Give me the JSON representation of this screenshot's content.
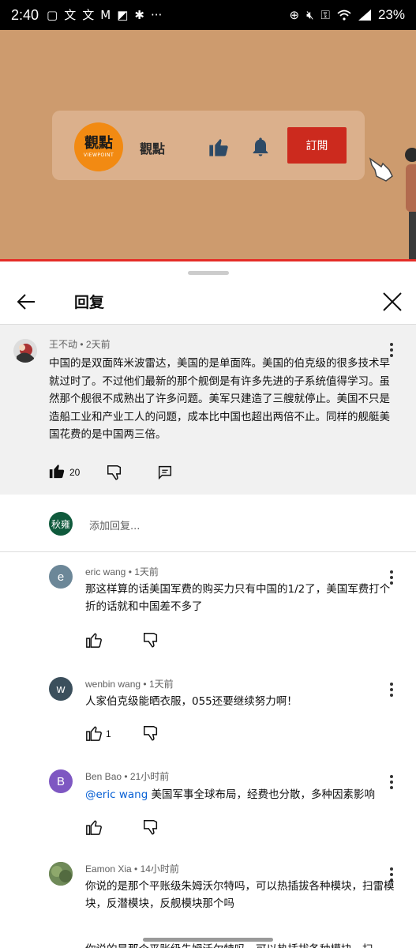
{
  "status_bar": {
    "time": "2:40",
    "battery": "23%",
    "left_icons": [
      "message-icon",
      "translate-icon",
      "translate-icon",
      "gmail-icon",
      "photo-icon",
      "maple-leaf-icon",
      "more-icon"
    ],
    "right_icons": [
      "add-circle-icon",
      "mute-icon",
      "key-icon",
      "wifi-icon",
      "signal-icon"
    ]
  },
  "video": {
    "channel_name": "觀點",
    "logo_text": "觀點",
    "logo_sub": "VIEWPOINT",
    "subscribe_label": "訂閱",
    "colors": {
      "background": "#cd9b6e",
      "subscribe": "#cc2a1e",
      "logo": "#f28a12"
    }
  },
  "sheet": {
    "title": "回复"
  },
  "parent_comment": {
    "author": "王不动",
    "time": "2天前",
    "text": "中国的是双面阵米波雷达，美国的是单面阵。美国的伯克级的很多技术早就过时了。不过他们最新的那个舰倒是有许多先进的子系统值得学习。虽然那个舰很不成熟出了许多问题。美军只建造了三艘就停止。美国不只是造船工业和产业工人的问题，成本比中国也超出两倍不止。同样的舰艇美国花费的是中国两三倍。",
    "likes": "20"
  },
  "add_reply": {
    "avatar_text": "秋雍",
    "placeholder": "添加回复..."
  },
  "replies": [
    {
      "author": "eric wang",
      "time": "1天前",
      "avatar_letter": "e",
      "avatar_color": "#6c8798",
      "mention": "",
      "text": "那这样算的话美国军费的购买力只有中国的1/2了，美国军费打个折的话就和中国差不多了",
      "likes": ""
    },
    {
      "author": "wenbin wang",
      "time": "1天前",
      "avatar_letter": "w",
      "avatar_color": "#3b4f5c",
      "mention": "",
      "text": "人家伯克级能晒衣服，055还要继续努力啊！",
      "likes": "1"
    },
    {
      "author": "Ben Bao",
      "time": "21小时前",
      "avatar_letter": "B",
      "avatar_color": "#7e57c2",
      "mention": "@eric wang",
      "text": " 美国军事全球布局，经费也分散，多种因素影响",
      "likes": ""
    },
    {
      "author": "Eamon Xia",
      "time": "14小时前",
      "avatar_letter": "",
      "avatar_color": "#6b7d5a",
      "mention": "",
      "text": "你说的是那个平账级朱姆沃尔特吗，可以热插拔各种模块，扫雷模块，反潜模块，反舰模块那个吗",
      "likes": ""
    }
  ],
  "partial_text": "你说的是那个平账级朱姆沃尔特吗，可以热插拔各种模块，扫"
}
